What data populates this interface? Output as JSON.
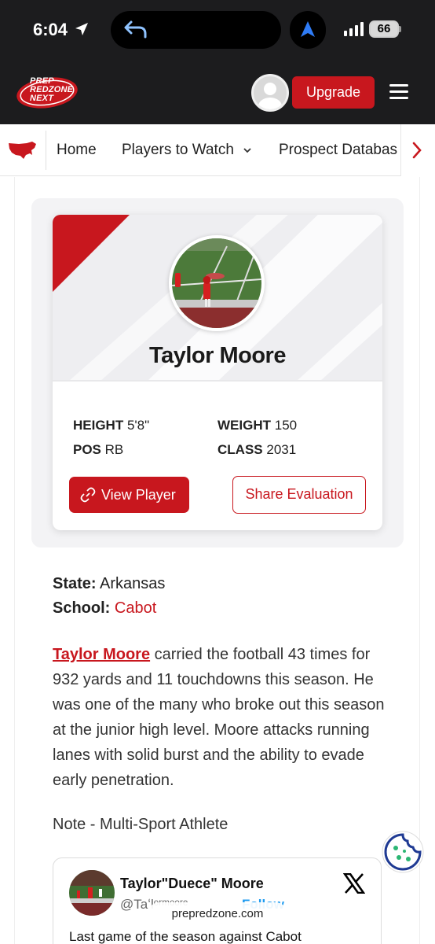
{
  "status_bar": {
    "time": "6:04",
    "battery": "66"
  },
  "header": {
    "logo_text": [
      "PREP",
      "REDZONE",
      "NEXT"
    ],
    "upgrade_label": "Upgrade"
  },
  "nav": {
    "items": [
      "Home",
      "Players to Watch",
      "Prospect Databas"
    ],
    "players_dropdown_caret": "⌄"
  },
  "player": {
    "name": "Taylor Moore",
    "height_label": "HEIGHT",
    "height": "5'8\"",
    "weight_label": "WEIGHT",
    "weight": "150",
    "pos_label": "POS",
    "pos": "RB",
    "class_label": "CLASS",
    "class": "2031",
    "view_label": "View Player",
    "share_label": "Share Evaluation"
  },
  "info": {
    "state_label": "State:",
    "state": "Arkansas",
    "school_label": "School:",
    "school": "Cabot"
  },
  "article": {
    "name_link": "Taylor Moore",
    "body": " carried the football 43 times for 932 yards and 11 touchdowns this season. He was one of the many who broke out this season at the junior high level. Moore attacks running lanes with solid burst and the ability to evade early penetration.",
    "note": "Note - Multi-Sport Athlete"
  },
  "tweet": {
    "name": "Taylor\"Duece\" Moore",
    "handle": "@Taʻlᵒʳᵐᵒᵒʳᵉ",
    "follow": "Follow",
    "text": "Last game of the season against Cabot"
  },
  "browser": {
    "url": "prepredzone.com"
  },
  "colors": {
    "brand_red": "#c8171e",
    "header_bg": "#1c1c1e"
  }
}
